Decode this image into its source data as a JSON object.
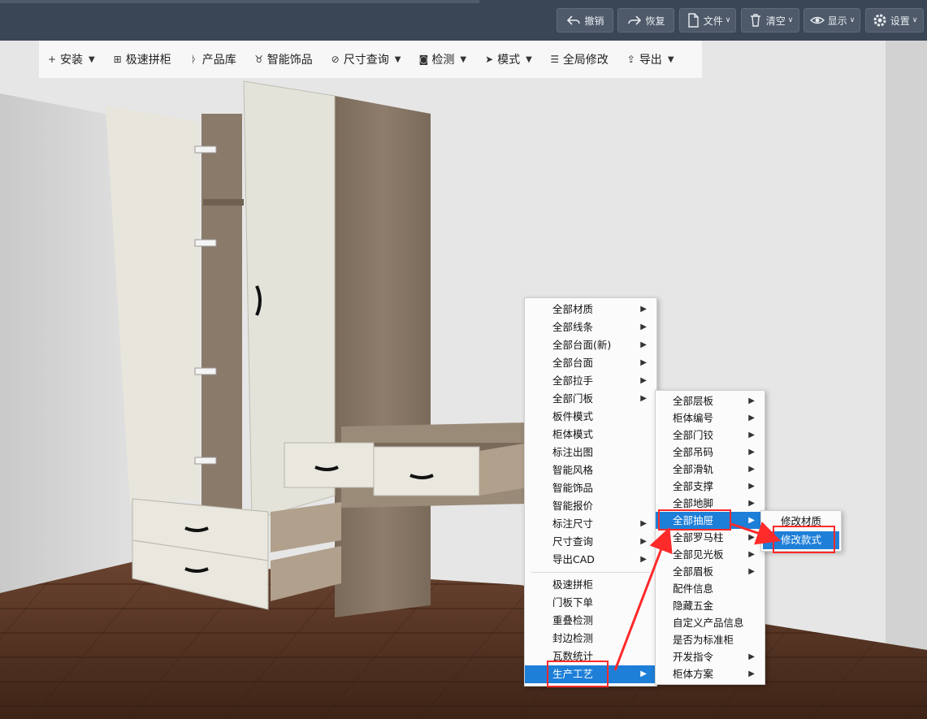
{
  "topbar": {
    "buttons": [
      {
        "label": "撤销",
        "icon": "undo-icon",
        "has_caret": false
      },
      {
        "label": "恢复",
        "icon": "redo-icon",
        "has_caret": false
      },
      {
        "label": "文件",
        "icon": "file-icon",
        "has_caret": true
      },
      {
        "label": "清空",
        "icon": "trash-icon",
        "has_caret": true
      },
      {
        "label": "显示",
        "icon": "eye-icon",
        "has_caret": true
      },
      {
        "label": "设置",
        "icon": "gear-icon",
        "has_caret": true
      }
    ]
  },
  "toolbar": {
    "items": [
      {
        "label": "安装",
        "icon": "plus-icon",
        "glyph": "+",
        "has_caret": true
      },
      {
        "label": "极速拼柜",
        "icon": "cabinet-icon",
        "glyph": "⊞",
        "has_caret": false
      },
      {
        "label": "产品库",
        "icon": "library-icon",
        "glyph": "ᚦ",
        "has_caret": false
      },
      {
        "label": "智能饰品",
        "icon": "decor-icon",
        "glyph": "♉",
        "has_caret": false
      },
      {
        "label": "尺寸查询",
        "icon": "ruler-icon",
        "glyph": "⊘",
        "has_caret": true
      },
      {
        "label": "检测",
        "icon": "detect-icon",
        "glyph": "◙",
        "has_caret": true
      },
      {
        "label": "模式",
        "icon": "cursor-icon",
        "glyph": "➤",
        "has_caret": true
      },
      {
        "label": "全局修改",
        "icon": "sliders-icon",
        "glyph": "☰",
        "has_caret": false
      },
      {
        "label": "导出",
        "icon": "export-icon",
        "glyph": "⇪",
        "has_caret": true
      }
    ]
  },
  "menu_main": {
    "group1": [
      {
        "label": "全部材质",
        "submenu": true
      },
      {
        "label": "全部线条",
        "submenu": true
      },
      {
        "label": "全部台面(新)",
        "submenu": true
      },
      {
        "label": "全部台面",
        "submenu": true
      },
      {
        "label": "全部拉手",
        "submenu": true
      },
      {
        "label": "全部门板",
        "submenu": true
      },
      {
        "label": "板件模式",
        "submenu": false
      },
      {
        "label": "柜体模式",
        "submenu": false
      },
      {
        "label": "标注出图",
        "submenu": false
      },
      {
        "label": "智能风格",
        "submenu": false
      },
      {
        "label": "智能饰品",
        "submenu": false
      },
      {
        "label": "智能报价",
        "submenu": false
      },
      {
        "label": "标注尺寸",
        "submenu": true
      },
      {
        "label": "尺寸查询",
        "submenu": true
      },
      {
        "label": "导出CAD",
        "submenu": true
      }
    ],
    "group2": [
      {
        "label": "极速拼柜",
        "submenu": false
      },
      {
        "label": "门板下单",
        "submenu": false
      },
      {
        "label": "重叠检测",
        "submenu": false
      },
      {
        "label": "封边检测",
        "submenu": false
      },
      {
        "label": "瓦数统计",
        "submenu": false
      },
      {
        "label": "生产工艺",
        "submenu": true,
        "highlighted": true
      }
    ]
  },
  "menu_sub": {
    "items": [
      {
        "label": "全部层板",
        "submenu": true
      },
      {
        "label": "柜体编号",
        "submenu": true
      },
      {
        "label": "全部门铰",
        "submenu": true
      },
      {
        "label": "全部吊码",
        "submenu": true
      },
      {
        "label": "全部滑轨",
        "submenu": true
      },
      {
        "label": "全部支撑",
        "submenu": true
      },
      {
        "label": "全部地脚",
        "submenu": true
      },
      {
        "label": "全部抽屉",
        "submenu": true,
        "highlighted": true
      },
      {
        "label": "全部罗马柱",
        "submenu": true
      },
      {
        "label": "全部见光板",
        "submenu": true
      },
      {
        "label": "全部眉板",
        "submenu": true
      },
      {
        "label": "配件信息",
        "submenu": false
      },
      {
        "label": "隐藏五金",
        "submenu": false
      },
      {
        "label": "自定义产品信息",
        "submenu": false
      },
      {
        "label": "是否为标准柜",
        "submenu": false
      },
      {
        "label": "开发指令",
        "submenu": true
      },
      {
        "label": "柜体方案",
        "submenu": true
      }
    ]
  },
  "menu_sub2": {
    "items": [
      {
        "label": "修改材质",
        "highlighted": false
      },
      {
        "label": "修改款式",
        "highlighted": true
      }
    ]
  },
  "colors": {
    "topbar": "#3a4656",
    "highlight": "#1e7fd8",
    "annotation": "#ff2a2a",
    "floor": "#4a2c1c",
    "cabinet_wood": "#8a7a6a",
    "door_white": "#e8e6dc"
  }
}
